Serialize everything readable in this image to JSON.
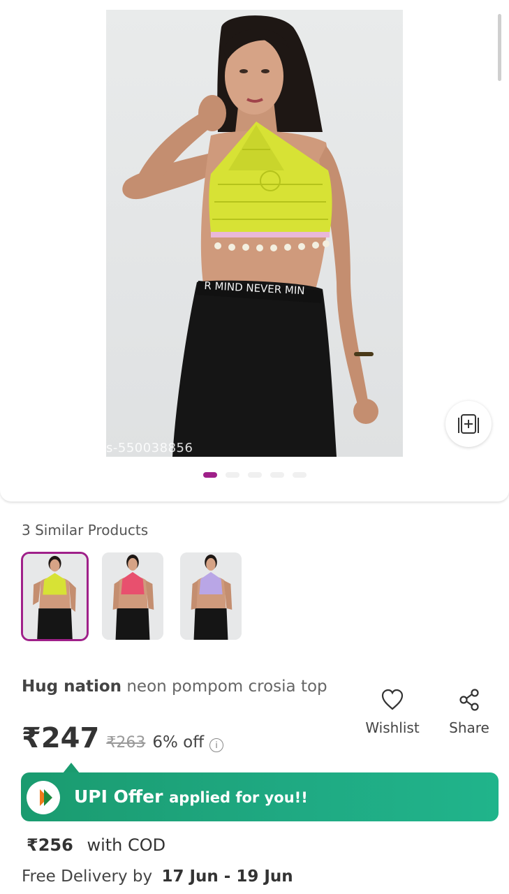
{
  "gallery": {
    "watermark": "s-550038856",
    "pagination": {
      "total": 5,
      "active": 1
    },
    "accent_color": "#9f2089"
  },
  "similar": {
    "title": "3 Similar Products",
    "items": [
      {
        "top_color": "#d7e235"
      },
      {
        "top_color": "#e8506e"
      },
      {
        "top_color": "#b9a6e6"
      }
    ]
  },
  "product": {
    "brand": "Hug nation",
    "name": "neon pompom crosia top",
    "price": "₹247",
    "mrp": "₹263",
    "discount": "6% off",
    "info_icon": "info-icon"
  },
  "actions": {
    "wishlist": "Wishlist",
    "share": "Share"
  },
  "upi": {
    "title": "UPI Offer",
    "subtitle": "applied for you!!",
    "color": "#1fa982"
  },
  "cod": {
    "price": "₹256",
    "label": "with COD"
  },
  "delivery": {
    "label": "Free Delivery by",
    "dates": "17 Jun - 19 Jun"
  }
}
